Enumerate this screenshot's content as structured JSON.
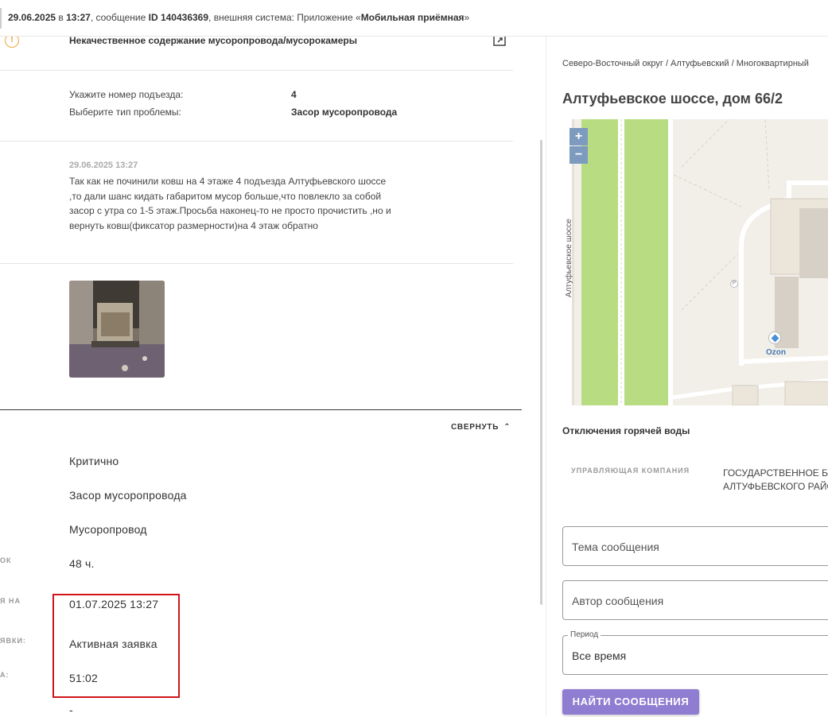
{
  "header": {
    "date": "29.06.2025",
    "in": "в",
    "time": "13:27",
    "msg_prefix": ", сообщение",
    "msg_id": "ID 140436369",
    "system_prefix": ", внешняя система: Приложение «",
    "system_name": "Мобильная приёмная",
    "system_suffix": "»"
  },
  "left": {
    "category_title": "Некачественное содержание мусоропровода/мусорокамеры",
    "details": [
      {
        "label": "Укажите номер подъезда:",
        "value": "4"
      },
      {
        "label": "Выберите тип проблемы:",
        "value": "Засор мусоропровода"
      }
    ],
    "message": {
      "date": "29.06.2025 13:27",
      "text": "Так как не починили ковш на 4 этаже 4 подъезда Алтуфьевского шоссе ,то дали шанс кидать габаритом мусор больше,что повлекло за собой засор с утра со 1-5 этаж.Просьба наконец-то не просто прочистить ,но и вернуть ковш(фиксатор размерности)на 4 этаж обратно"
    },
    "collapse_label": "СВЕРНУТЬ",
    "fields": [
      {
        "label": "",
        "value": "Критично"
      },
      {
        "label": "",
        "value": "Засор мусоропровода"
      },
      {
        "label": "",
        "value": "Мусоропровод"
      },
      {
        "label": "ОК",
        "value": "48 ч."
      },
      {
        "label": "Я НА",
        "value": "01.07.2025 13:27"
      },
      {
        "label": "ЯВКИ:",
        "value": "Активная заявка"
      },
      {
        "label": "А:",
        "value": "51:02"
      },
      {
        "label": "",
        "value": "-"
      }
    ]
  },
  "right": {
    "breadcrumb": "Северо-Восточный округ / Алтуфьевский / Многоквартирный",
    "address": "Алтуфьевское шоссе, дом 66/2",
    "map": {
      "zoom_in": "+",
      "zoom_out": "−",
      "street_label": "Алтуфьевское шоссе",
      "poi_label": "Ozon",
      "parking": "P"
    },
    "section_title": "Отключения горячей воды",
    "uk_label": "УПРАВЛЯЮЩАЯ КОМПАНИЯ",
    "uk_value_line1": "ГОСУДАРСТВЕННОЕ БК",
    "uk_value_line2": "АЛТУФЬЕВСКОГО РАЙО",
    "subject_placeholder": "Тема сообщения",
    "author_placeholder": "Автор сообщения",
    "period_label": "Период",
    "period_value": "Все время",
    "search_button": "НАЙТИ СООБЩЕНИЯ"
  },
  "colors": {
    "accent_button": "#8f7dd1",
    "highlight_border": "#d0141a",
    "warning": "#f0a33a",
    "map_green": "#b8dc82"
  }
}
